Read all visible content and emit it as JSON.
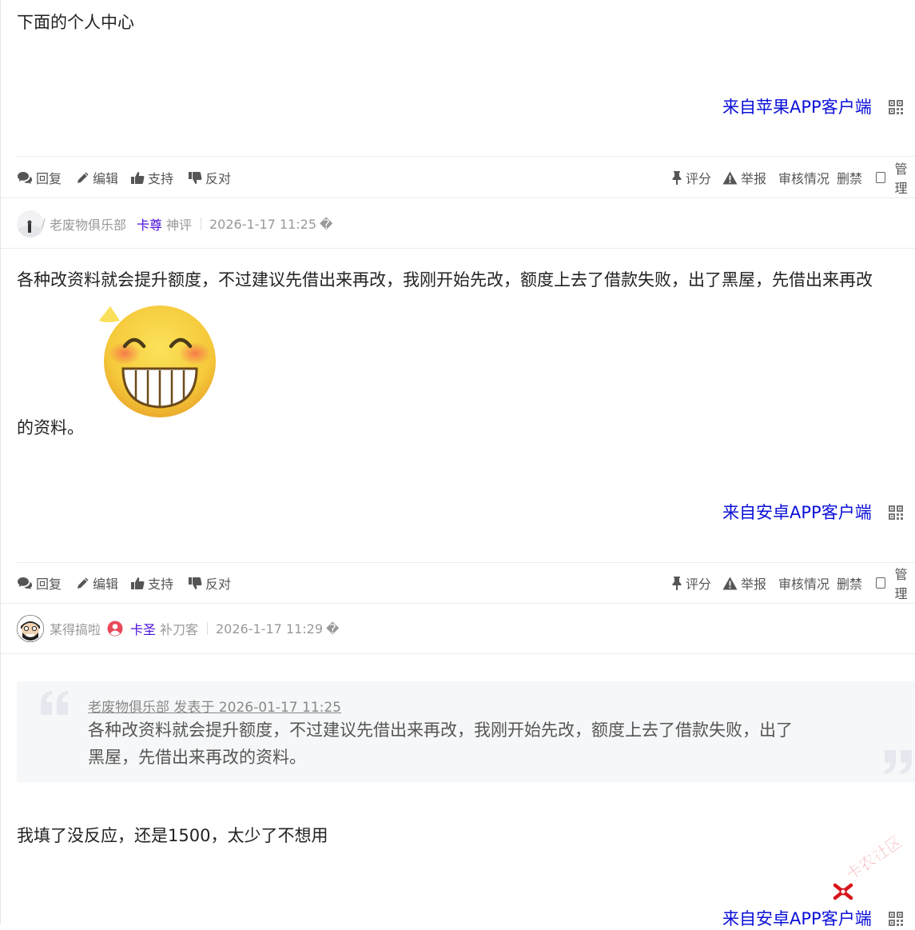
{
  "posts": [
    {
      "content": "下面的个人中心",
      "source": "来自苹果APP客户端"
    },
    {
      "author": "老废物俱乐部",
      "rank": "卡尊",
      "title": "神评",
      "time": "2026-1-17 11:25",
      "content_line1": "各种改资料就会提升额度，不过建议先借出来再改，我刚开始先改，额度上去了借款失败，出了黑屋，先借出来再改",
      "content_line2": "的资料。",
      "source": "来自安卓APP客户端"
    },
    {
      "author": "某得搞啦",
      "rank": "卡圣",
      "title": "补刀客",
      "time": "2026-1-17 11:29",
      "quote_header": "老废物俱乐部 发表于 2026-01-17 11:25",
      "quote_line1": "各种改资料就会提升额度，不过建议先借出来再改，我刚开始先改，额度上去了借款失败，出了",
      "quote_line2": "黑屋，先借出来再改的资料。",
      "content": "我填了没反应，还是1500，太少了不想用",
      "source": "来自安卓APP客户端"
    }
  ],
  "actions": {
    "reply": "回复",
    "edit": "编辑",
    "support": "支持",
    "oppose": "反对",
    "rate": "评分",
    "report": "举报",
    "audit": "审核情况",
    "ban": "删禁",
    "manage": "管理"
  },
  "time_suffix": "�",
  "watermark": "卡农社区",
  "colors": {
    "source_link": "#0b10d8",
    "rank": "#4c10d8",
    "meta_text": "#999999",
    "quote_bg": "#f6f7f8"
  },
  "icons": [
    "comments-icon",
    "pencil-icon",
    "thumbs-up-icon",
    "thumbs-down-icon",
    "pin-icon",
    "warning-icon",
    "checkbox",
    "qr-code-icon",
    "user-circle-icon",
    "grin-emoji",
    "quote-open-icon",
    "quote-close-icon"
  ]
}
